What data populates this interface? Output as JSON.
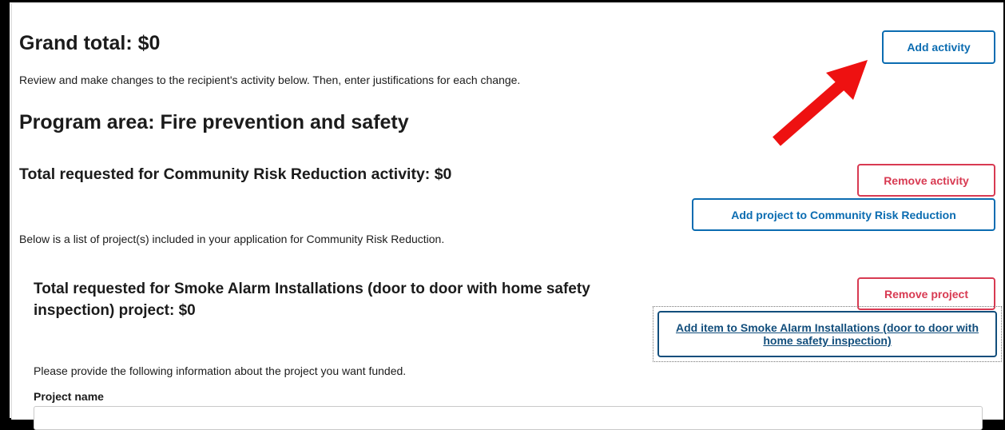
{
  "header": {
    "grand_total": "Grand total: $0",
    "instructions": "Review and make changes to the recipient's activity below. Then, enter justifications for each change."
  },
  "program": {
    "title": "Program area: Fire prevention and safety"
  },
  "activity": {
    "total": "Total requested for Community Risk Reduction activity: $0",
    "list_note": "Below is a list of project(s) included in your application for Community Risk Reduction."
  },
  "project": {
    "total": "Total requested for Smoke Alarm Installations (door to door with home safety inspection) project: $0",
    "provide_info": "Please provide the following information about the project you want funded.",
    "name_label": "Project name",
    "name_value": ""
  },
  "buttons": {
    "add_activity": "Add activity",
    "remove_activity": "Remove activity",
    "add_project": "Add project to Community Risk Reduction",
    "remove_project": "Remove project",
    "add_item": "Add item to Smoke Alarm Installations (door to door with home safety inspection)"
  },
  "colors": {
    "primary_blue": "#0b6cb1",
    "danger_red": "#d83a52",
    "annotation_arrow": "#ee1111"
  },
  "annotation": {
    "icon": "red-arrow-icon"
  }
}
